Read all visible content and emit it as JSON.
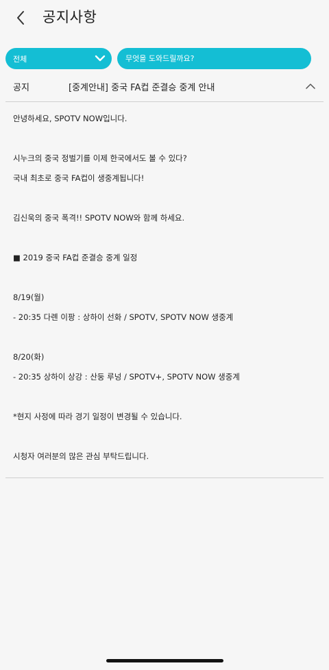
{
  "header": {
    "title": "공지사항"
  },
  "filters": {
    "category_value": "전체",
    "search_placeholder": "무엇을 도와드릴까요?"
  },
  "notice": {
    "category": "공지",
    "title": "[중계안내] 중국 FA컵 준결승 중계 안내",
    "body_lines": [
      "안녕하세요, SPOTV NOW입니다.",
      "시누크의 중국 정벌기를 이제 한국에서도 볼 수 있다?",
      "국내 최초로 중국 FA컵이 생중계됩니다!",
      "김신욱의 중국 폭격!! SPOTV NOW와 함께 하세요.",
      "■ 2019 중국 FA컵 준결승 중계 일정",
      "8/19(월)",
      "- 20:35 다롄 이팡 : 상하이 선화 / SPOTV, SPOTV NOW 생중계",
      "8/20(화)",
      "- 20:35 상하이 상강 : 산둥 루넝 / SPOTV+, SPOTV NOW 생중계",
      "*현지 사정에 따라 경기 일정이 변경될 수 있습니다.",
      "시청자 여러분의 많은 관심 부탁드립니다."
    ]
  },
  "icons": {
    "back": "chevron-left-icon",
    "dropdown": "chevron-down-icon",
    "collapse": "chevron-up-icon"
  },
  "colors": {
    "accent": "#14bed4",
    "background": "#f6f6f6",
    "divider": "#cfcfcf"
  }
}
